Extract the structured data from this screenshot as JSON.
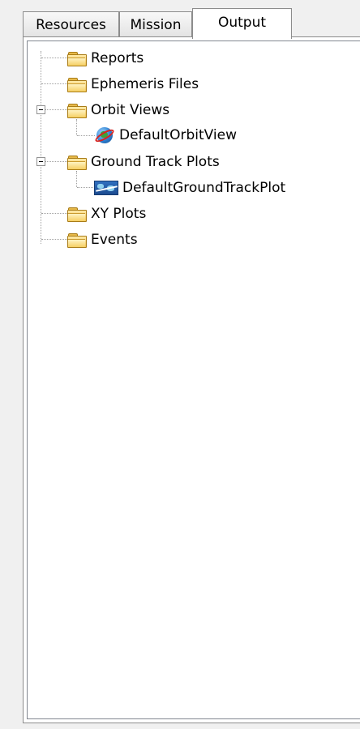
{
  "tabs": [
    {
      "label": "Resources",
      "active": false
    },
    {
      "label": "Mission",
      "active": false
    },
    {
      "label": "Output",
      "active": true
    }
  ],
  "tree": {
    "nodes": [
      {
        "label": "Reports",
        "icon": "folder-icon",
        "expanded": null
      },
      {
        "label": "Ephemeris Files",
        "icon": "folder-icon",
        "expanded": null
      },
      {
        "label": "Orbit Views",
        "icon": "folder-icon",
        "expanded": true,
        "children": [
          {
            "label": "DefaultOrbitView",
            "icon": "globe-orbit-icon"
          }
        ]
      },
      {
        "label": "Ground Track Plots",
        "icon": "folder-icon",
        "expanded": true,
        "children": [
          {
            "label": "DefaultGroundTrackPlot",
            "icon": "ground-track-icon"
          }
        ]
      },
      {
        "label": "XY Plots",
        "icon": "folder-icon",
        "expanded": null
      },
      {
        "label": "Events",
        "icon": "folder-icon",
        "expanded": null
      }
    ]
  }
}
